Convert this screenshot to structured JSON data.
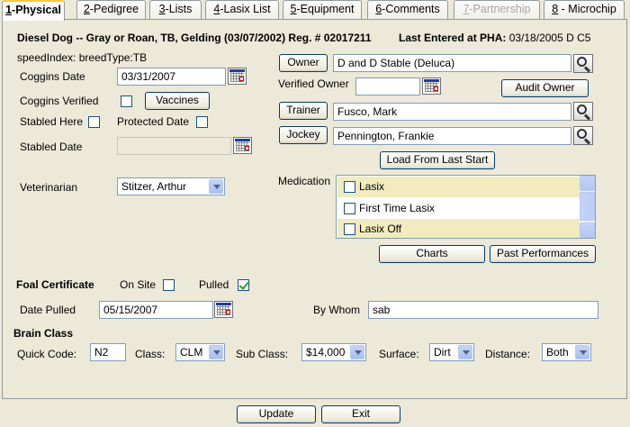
{
  "tabs": [
    {
      "label": "1-Physical",
      "key": "1",
      "rest": "-Physical",
      "active": true
    },
    {
      "label": "2-Pedigree",
      "key": "2",
      "rest": "-Pedigree"
    },
    {
      "label": "3-Lists",
      "key": "3",
      "rest": "-Lists"
    },
    {
      "label": "4-Lasix List",
      "key": "4",
      "rest": "-Lasix List"
    },
    {
      "label": "5-Equipment",
      "key": "5",
      "rest": "-Equipment"
    },
    {
      "label": "6-Comments",
      "key": "6",
      "rest": "-Comments"
    },
    {
      "label": "7-Partnership",
      "key": "7",
      "rest": "-Partnership",
      "disabled": true
    },
    {
      "label": "8 - Microchip",
      "key": "8",
      "rest": " - Microchip"
    }
  ],
  "horse": {
    "header": "Diesel Dog --   Gray or Roan, TB, Gelding (03/07/2002) Reg. # 02017211",
    "last_entered": "Last Entered at PHA:",
    "last_entered_value": "03/18/2005 D C5",
    "speed_index": "speedIndex: breedType:TB"
  },
  "physical": {
    "coggins_date_label": "Coggins Date",
    "coggins_date": "03/31/2007",
    "coggins_verified_label": "Coggins Verified",
    "vaccines_button": "Vaccines",
    "stabled_here_label": "Stabled Here",
    "protected_date_label": "Protected Date",
    "stabled_date_label": "Stabled Date",
    "stabled_date": "",
    "veterinarian_label": "Veterinarian",
    "veterinarian": "Stitzer, Arthur"
  },
  "people": {
    "owner_button": "Owner",
    "owner": "D and D Stable (Deluca)",
    "verified_owner_label": "Verified Owner",
    "verified_owner": "",
    "audit_owner_button": "Audit Owner",
    "trainer_button": "Trainer",
    "trainer": "Fusco, Mark",
    "jockey_button": "Jockey",
    "jockey": "Pennington, Frankie",
    "load_last_start_button": "Load From Last Start"
  },
  "medication": {
    "label": "Medication",
    "items": [
      {
        "label": "Lasix",
        "checked": false,
        "highlight": true
      },
      {
        "label": "First Time Lasix",
        "checked": false,
        "highlight": false
      },
      {
        "label": "Lasix Off",
        "checked": false,
        "highlight": true
      }
    ],
    "charts_button": "Charts",
    "past_performances_button": "Past Performances"
  },
  "foal": {
    "title": "Foal Certificate",
    "on_site_label": "On Site",
    "on_site": false,
    "pulled_label": "Pulled",
    "pulled": true,
    "date_pulled_label": "Date Pulled",
    "date_pulled": "05/15/2007",
    "by_whom_label": "By Whom",
    "by_whom": "sab"
  },
  "brain_class": {
    "title": "Brain Class",
    "quick_code_label": "Quick Code:",
    "quick_code": "N2",
    "class_label": "Class:",
    "class_value": "CLM",
    "sub_class_label": "Sub Class:",
    "sub_class_value": "$14,000",
    "surface_label": "Surface:",
    "surface_value": "Dirt",
    "distance_label": "Distance:",
    "distance_value": "Both"
  },
  "footer": {
    "update_button": "Update",
    "exit_button": "Exit"
  },
  "colors": {
    "background": "#ece9d8",
    "active_tab_accent": "#ffc83c",
    "medication_highlight": "#f1ebbd",
    "check_green": "#21a121"
  }
}
